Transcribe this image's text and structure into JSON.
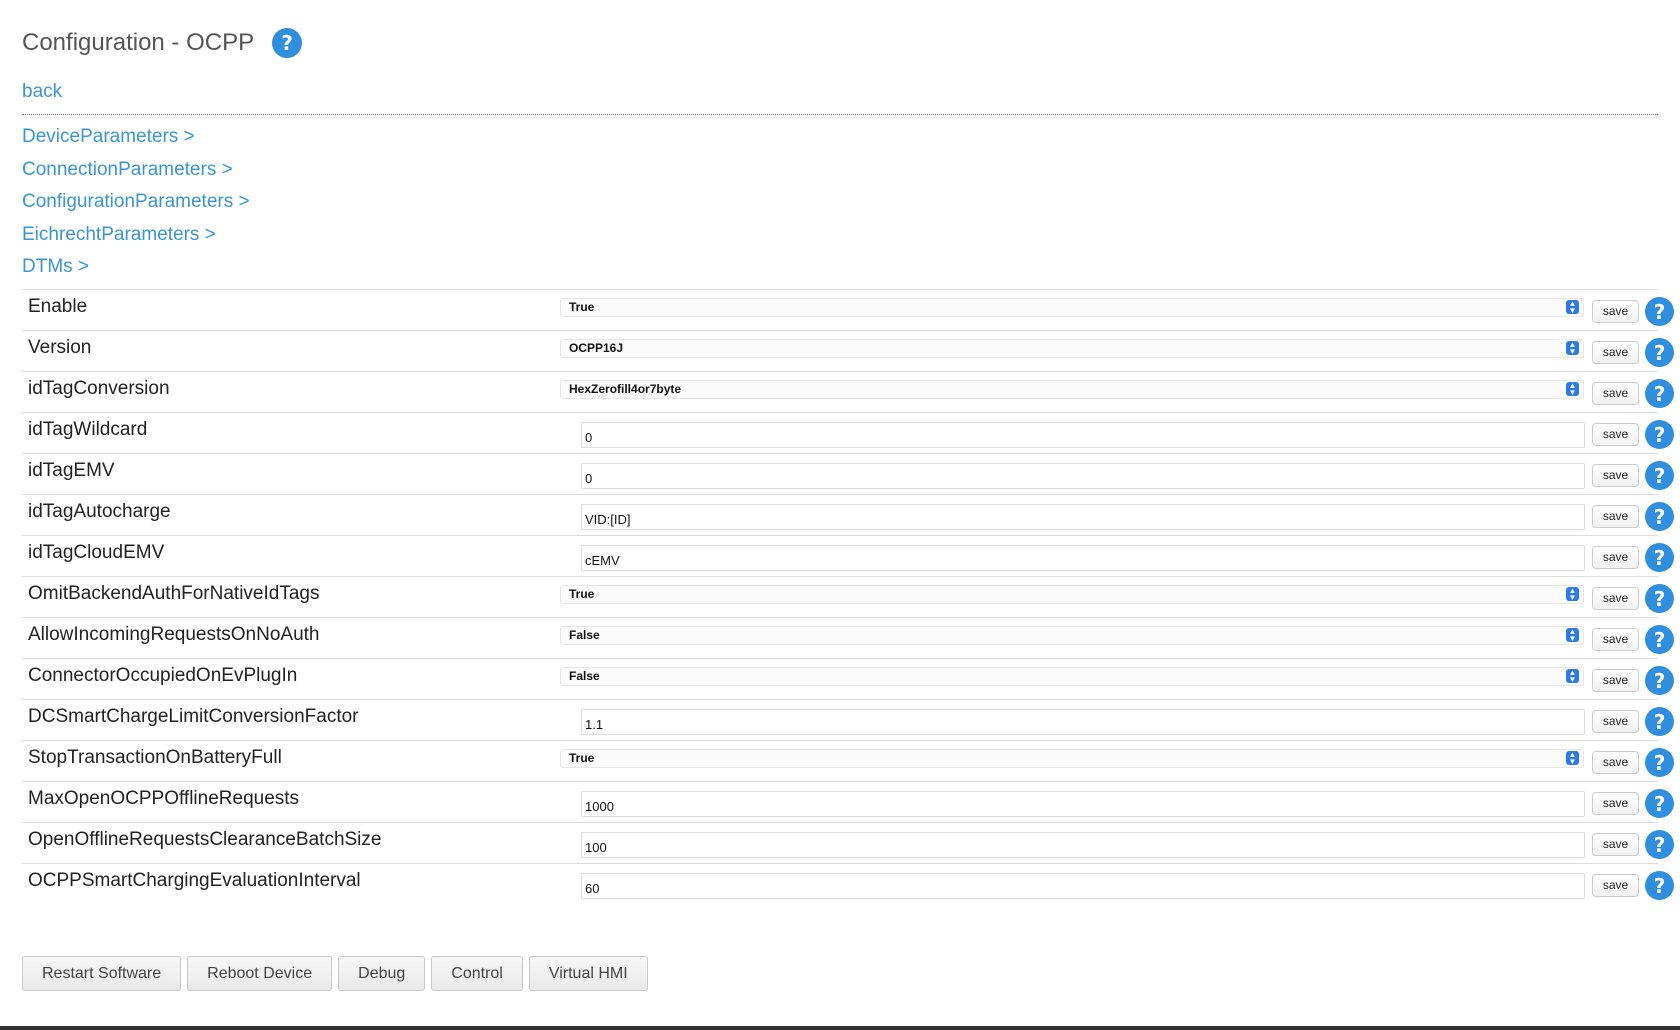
{
  "page": {
    "title": "Configuration - OCPP",
    "help_icon": "?",
    "back_label": "back"
  },
  "nav_links": [
    "DeviceParameters >",
    "ConnectionParameters >",
    "ConfigurationParameters >",
    "EichrechtParameters >",
    "DTMs >"
  ],
  "save_label": "save",
  "params": [
    {
      "label": "Enable",
      "type": "select",
      "value": "True"
    },
    {
      "label": "Version",
      "type": "select",
      "value": "OCPP16J"
    },
    {
      "label": "idTagConversion",
      "type": "select",
      "value": "HexZerofill4or7byte"
    },
    {
      "label": "idTagWildcard",
      "type": "input",
      "value": "0"
    },
    {
      "label": "idTagEMV",
      "type": "input",
      "value": "0"
    },
    {
      "label": "idTagAutocharge",
      "type": "input",
      "value": "VID:[ID]"
    },
    {
      "label": "idTagCloudEMV",
      "type": "input",
      "value": "cEMV"
    },
    {
      "label": "OmitBackendAuthForNativeIdTags",
      "type": "select",
      "value": "True"
    },
    {
      "label": "AllowIncomingRequestsOnNoAuth",
      "type": "select",
      "value": "False"
    },
    {
      "label": "ConnectorOccupiedOnEvPlugIn",
      "type": "select",
      "value": "False"
    },
    {
      "label": "DCSmartChargeLimitConversionFactor",
      "type": "input",
      "value": "1.1"
    },
    {
      "label": "StopTransactionOnBatteryFull",
      "type": "select",
      "value": "True"
    },
    {
      "label": "MaxOpenOCPPOfflineRequests",
      "type": "input",
      "value": "1000"
    },
    {
      "label": "OpenOfflineRequestsClearanceBatchSize",
      "type": "input",
      "value": "100"
    },
    {
      "label": "OCPPSmartChargingEvaluationInterval",
      "type": "input",
      "value": "60"
    }
  ],
  "actions": [
    "Restart Software",
    "Reboot Device",
    "Debug",
    "Control",
    "Virtual HMI"
  ],
  "colors": {
    "link": "#3a95d6",
    "help_badge": "#2f8fde",
    "select_arrow": "#2d7be8"
  }
}
